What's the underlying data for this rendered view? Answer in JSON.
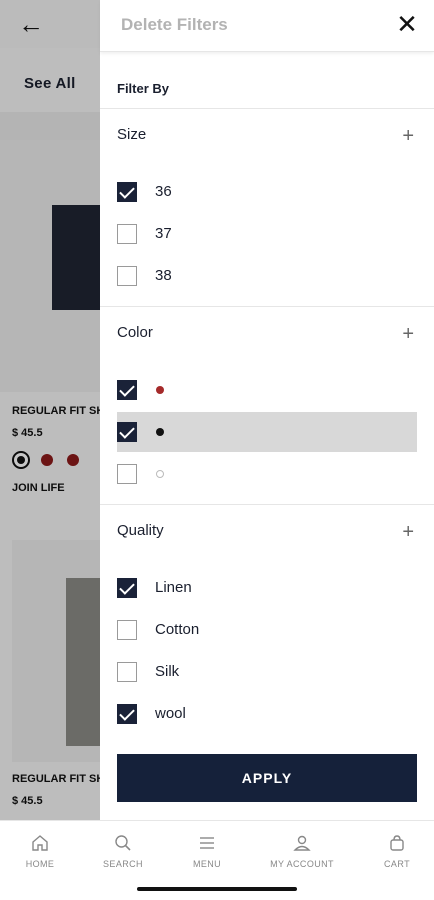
{
  "background": {
    "see_all": "See All",
    "products": [
      {
        "name": "REGULAR FIT SHI",
        "price": "$ 45.5"
      },
      {
        "name": "REGULAR FIT SHI",
        "price": "$ 45.5"
      }
    ],
    "join_life": "JOIN LIFE",
    "swatch_colors": [
      "#111111",
      "#8b1a1a",
      "#8b1a1a"
    ]
  },
  "panel": {
    "delete_filters": "Delete Filters",
    "filter_by": "Filter By",
    "sections": [
      {
        "title": "Size",
        "options": [
          {
            "label": "36",
            "checked": true
          },
          {
            "label": "37",
            "checked": false
          },
          {
            "label": "38",
            "checked": false
          }
        ]
      },
      {
        "title": "Color",
        "options": [
          {
            "color": "#a52a2a",
            "checked": true,
            "highlight": false
          },
          {
            "color": "#111111",
            "checked": true,
            "highlight": true
          },
          {
            "color": "#ffffff",
            "checked": false,
            "highlight": false
          }
        ]
      },
      {
        "title": "Quality",
        "options": [
          {
            "label": "Linen",
            "checked": true
          },
          {
            "label": "Cotton",
            "checked": false
          },
          {
            "label": "Silk",
            "checked": false
          },
          {
            "label": "wool",
            "checked": true
          }
        ]
      }
    ],
    "apply_label": "APPLY"
  },
  "bottom_nav": [
    {
      "label": "HOME",
      "icon": "home-icon"
    },
    {
      "label": "SEARCH",
      "icon": "search-icon"
    },
    {
      "label": "MENU",
      "icon": "menu-icon"
    },
    {
      "label": "MY ACCOUNT",
      "icon": "account-icon"
    },
    {
      "label": "CART",
      "icon": "cart-icon"
    }
  ],
  "colors": {
    "accent": "#15213a",
    "muted_text": "#b3b3b3",
    "highlight_row": "#d8d8d8"
  }
}
